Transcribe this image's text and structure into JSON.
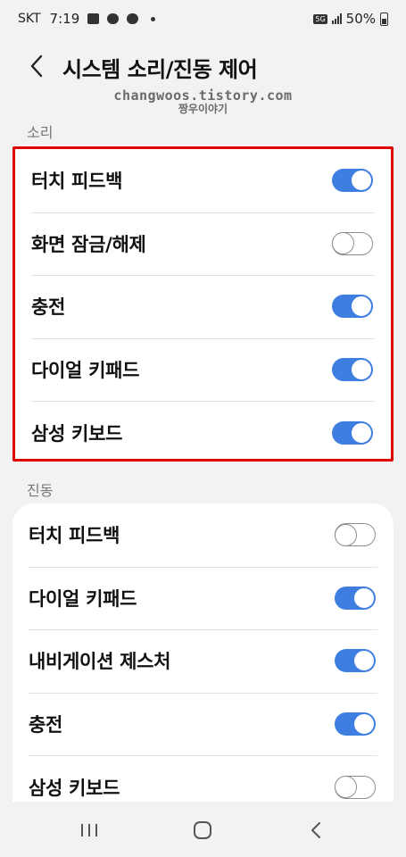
{
  "status_bar": {
    "carrier": "SKT",
    "time": "7:19",
    "network": "5G",
    "battery": "50%",
    "battery_level": 0.5
  },
  "header": {
    "title": "시스템 소리/진동 제어",
    "back_icon": "chevron-left-icon"
  },
  "watermark": {
    "line1": "changwoos.tistory.com",
    "line2": "짱우이야기"
  },
  "sound_section": {
    "title": "소리",
    "items": [
      {
        "label": "터치 피드백",
        "on": true
      },
      {
        "label": "화면 잠금/해제",
        "on": false
      },
      {
        "label": "충전",
        "on": true
      },
      {
        "label": "다이얼 키패드",
        "on": true
      },
      {
        "label": "삼성 키보드",
        "on": true
      }
    ]
  },
  "vibration_section": {
    "title": "진동",
    "items": [
      {
        "label": "터치 피드백",
        "on": false
      },
      {
        "label": "다이얼 키패드",
        "on": true
      },
      {
        "label": "내비게이션 제스처",
        "on": true
      },
      {
        "label": "충전",
        "on": true
      },
      {
        "label": "삼성 키보드",
        "on": false
      }
    ]
  },
  "colors": {
    "accent": "#3e7ee0",
    "highlight_box": "#e00000",
    "background": "#f2f2f4"
  },
  "nav_bar": {
    "recents_icon": "recents-icon",
    "home_icon": "home-icon",
    "back_icon": "back-icon"
  }
}
